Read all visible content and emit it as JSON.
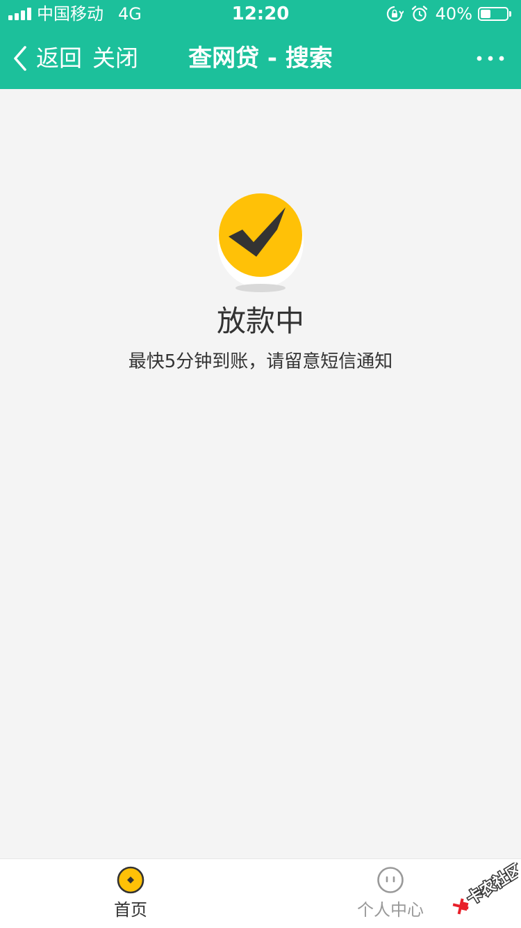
{
  "status_bar": {
    "carrier": "中国移动",
    "network": "4G",
    "time": "12:20",
    "battery_percent_label": "40%",
    "battery_level": 0.4,
    "icons": [
      "signal-icon",
      "orientation-lock-icon",
      "alarm-icon",
      "battery-icon"
    ]
  },
  "nav": {
    "back_label": "返回",
    "close_label": "关闭",
    "title": "查网贷 - 搜索",
    "more_icon": "more-dots-icon"
  },
  "main": {
    "status_icon": "checkmark-badge-icon",
    "status_title": "放款中",
    "status_subtitle": "最快5分钟到账，请留意短信通知"
  },
  "tab_bar": {
    "items": [
      {
        "label": "首页",
        "icon": "home-coin-icon",
        "active": true
      },
      {
        "label": "个人中心",
        "icon": "profile-face-icon",
        "active": false
      }
    ]
  },
  "watermark": {
    "text": "卡农社区"
  },
  "colors": {
    "brand_green": "#1cc09b",
    "badge_yellow": "#ffc107",
    "check_dark": "#333333",
    "background": "#f4f4f4",
    "tab_active": "#333333",
    "tab_inactive": "#999999",
    "watermark_red": "#e8202a"
  }
}
